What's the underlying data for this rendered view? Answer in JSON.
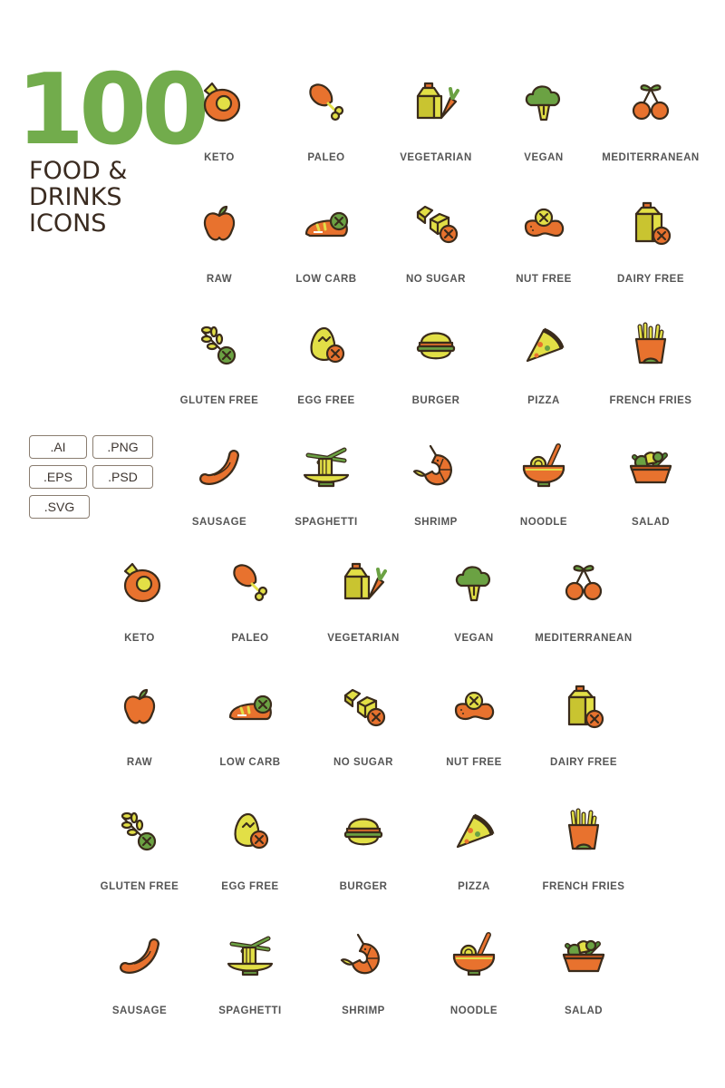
{
  "hero": {
    "count": "100",
    "subtitle_lines": [
      "FOOD &",
      "DRINKS",
      "ICONS"
    ]
  },
  "formats": [
    ".AI",
    ".PNG",
    ".EPS",
    ".PSD",
    ".SVG"
  ],
  "colors": {
    "brand_green": "#72ac4c",
    "outline": "#3a2b1b",
    "orange": "#e8722e",
    "yellow": "#e2df46",
    "green": "#6ba243",
    "label_gray": "#555555"
  },
  "grids": [
    {
      "name": "top",
      "icons": [
        {
          "icon": "keto-icon",
          "label": "KETO"
        },
        {
          "icon": "paleo-icon",
          "label": "PALEO"
        },
        {
          "icon": "vegetarian-icon",
          "label": "VEGETARIAN"
        },
        {
          "icon": "vegan-icon",
          "label": "VEGAN"
        },
        {
          "icon": "mediterranean-icon",
          "label": "MEDITERRANEAN"
        },
        {
          "icon": "raw-icon",
          "label": "RAW"
        },
        {
          "icon": "low-carb-icon",
          "label": "LOW CARB"
        },
        {
          "icon": "no-sugar-icon",
          "label": "NO SUGAR"
        },
        {
          "icon": "nut-free-icon",
          "label": "NUT FREE"
        },
        {
          "icon": "dairy-free-icon",
          "label": "DAIRY FREE"
        },
        {
          "icon": "gluten-free-icon",
          "label": "GLUTEN FREE"
        },
        {
          "icon": "egg-free-icon",
          "label": "EGG FREE"
        },
        {
          "icon": "burger-icon",
          "label": "BURGER"
        },
        {
          "icon": "pizza-icon",
          "label": "PIZZA"
        },
        {
          "icon": "french-fries-icon",
          "label": "FRENCH FRIES"
        },
        {
          "icon": "sausage-icon",
          "label": "SAUSAGE"
        },
        {
          "icon": "spaghetti-icon",
          "label": "SPAGHETTI"
        },
        {
          "icon": "shrimp-icon",
          "label": "SHRIMP"
        },
        {
          "icon": "noodle-icon",
          "label": "NOODLE"
        },
        {
          "icon": "salad-icon",
          "label": "SALAD"
        }
      ]
    },
    {
      "name": "bottom",
      "icons": [
        {
          "icon": "keto-icon",
          "label": "KETO"
        },
        {
          "icon": "paleo-icon",
          "label": "PALEO"
        },
        {
          "icon": "vegetarian-icon",
          "label": "VEGETARIAN"
        },
        {
          "icon": "vegan-icon",
          "label": "VEGAN"
        },
        {
          "icon": "mediterranean-icon",
          "label": "MEDITERRANEAN"
        },
        {
          "icon": "raw-icon",
          "label": "RAW"
        },
        {
          "icon": "low-carb-icon",
          "label": "LOW CARB"
        },
        {
          "icon": "no-sugar-icon",
          "label": "NO SUGAR"
        },
        {
          "icon": "nut-free-icon",
          "label": "NUT FREE"
        },
        {
          "icon": "dairy-free-icon",
          "label": "DAIRY FREE"
        },
        {
          "icon": "gluten-free-icon",
          "label": "GLUTEN FREE"
        },
        {
          "icon": "egg-free-icon",
          "label": "EGG FREE"
        },
        {
          "icon": "burger-icon",
          "label": "BURGER"
        },
        {
          "icon": "pizza-icon",
          "label": "PIZZA"
        },
        {
          "icon": "french-fries-icon",
          "label": "FRENCH FRIES"
        },
        {
          "icon": "sausage-icon",
          "label": "SAUSAGE"
        },
        {
          "icon": "spaghetti-icon",
          "label": "SPAGHETTI"
        },
        {
          "icon": "shrimp-icon",
          "label": "SHRIMP"
        },
        {
          "icon": "noodle-icon",
          "label": "NOODLE"
        },
        {
          "icon": "salad-icon",
          "label": "SALAD"
        }
      ]
    }
  ]
}
